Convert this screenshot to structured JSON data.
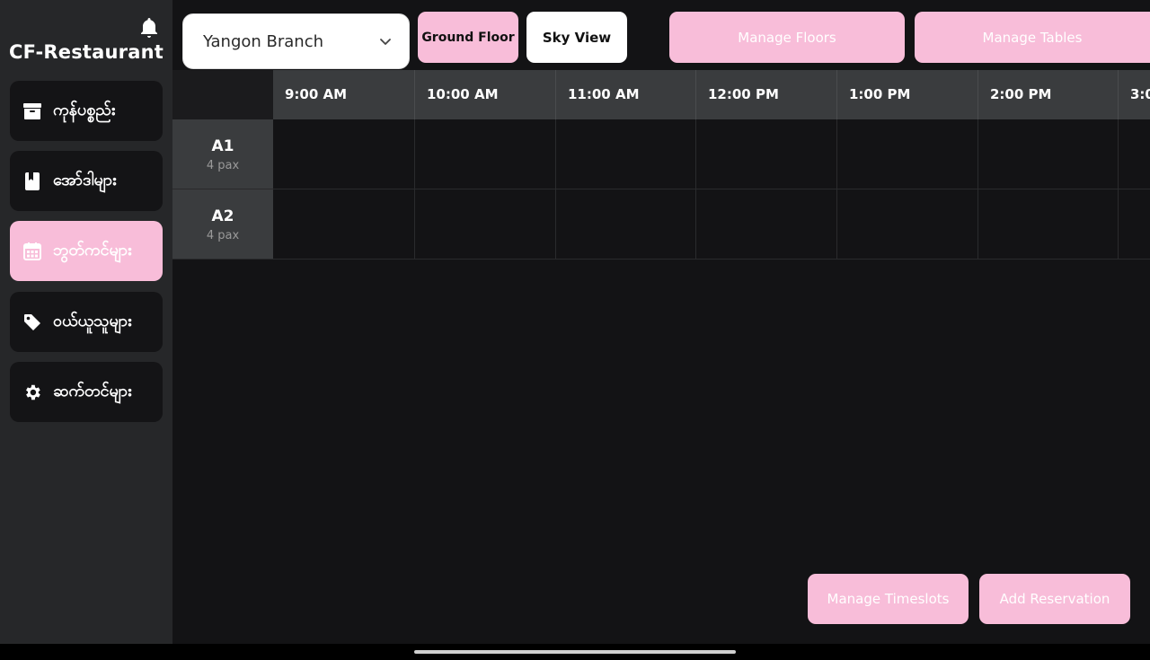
{
  "app": {
    "title": "CF-Restaurant"
  },
  "sidebar": {
    "items": [
      {
        "label": "ကုန်ပစ္စည်း",
        "icon": "archive-icon"
      },
      {
        "label": "အော်ဒါများ",
        "icon": "book-icon"
      },
      {
        "label": "ဘွတ်ကင်များ",
        "icon": "calendar-icon",
        "active": true
      },
      {
        "label": "ဝယ်ယူသူများ",
        "icon": "tag-icon"
      },
      {
        "label": "ဆက်တင်များ",
        "icon": "gear-icon"
      }
    ]
  },
  "toolbar": {
    "branch": "Yangon Branch",
    "floor_button": "Ground Floor",
    "view_button": "Sky View",
    "manage_floors": "Manage Floors",
    "manage_tables": "Manage Tables"
  },
  "timeline": {
    "times": [
      "9:00 AM",
      "10:00 AM",
      "11:00 AM",
      "12:00 PM",
      "1:00 PM",
      "2:00 PM",
      "3:0"
    ],
    "tables": [
      {
        "name": "A1",
        "pax": "4 pax"
      },
      {
        "name": "A2",
        "pax": "4 pax"
      }
    ]
  },
  "footer": {
    "manage_timeslots": "Manage Timeslots",
    "add_reservation": "Add Reservation"
  },
  "colors": {
    "accent": "#f8bdd9",
    "sidebar_bg": "#262729",
    "main_bg": "#131315",
    "header_bg": "#3a3c3e"
  }
}
